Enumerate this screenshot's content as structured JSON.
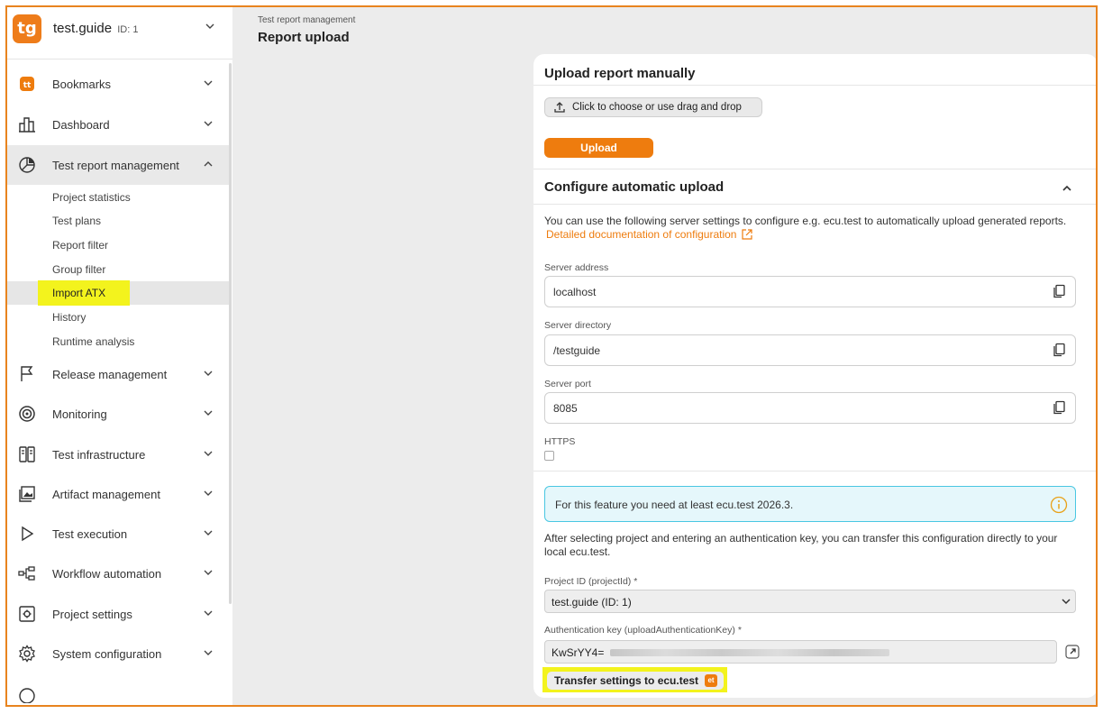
{
  "app": {
    "logo_text": "tg",
    "name": "test.guide",
    "id_label": "ID: 1"
  },
  "sidebar": {
    "items": [
      {
        "label": "Bookmarks",
        "icon": "bookmark-tt-icon"
      },
      {
        "label": "Dashboard",
        "icon": "bar-chart-icon"
      },
      {
        "label": "Test report management",
        "icon": "pie-chart-icon",
        "expanded": true
      },
      {
        "label": "Release management",
        "icon": "flag-icon"
      },
      {
        "label": "Monitoring",
        "icon": "radar-icon"
      },
      {
        "label": "Test infrastructure",
        "icon": "server-icon"
      },
      {
        "label": "Artifact management",
        "icon": "image-folder-icon"
      },
      {
        "label": "Test execution",
        "icon": "play-icon"
      },
      {
        "label": "Workflow automation",
        "icon": "workflow-icon"
      },
      {
        "label": "Project settings",
        "icon": "project-gear-icon"
      },
      {
        "label": "System configuration",
        "icon": "gear-icon"
      }
    ],
    "sub_items": [
      "Project statistics",
      "Test plans",
      "Report filter",
      "Group filter",
      "Import ATX",
      "History",
      "Runtime analysis"
    ],
    "selected_sub_item": "Import ATX"
  },
  "header": {
    "breadcrumb": "Test report management",
    "title": "Report upload"
  },
  "upload_manual": {
    "heading": "Upload report manually",
    "choose_label": "Click to choose or use drag and drop",
    "upload_label": "Upload"
  },
  "auto_upload": {
    "heading": "Configure automatic upload",
    "description": "You can use the following server settings to configure e.g. ecu.test to automatically upload generated reports.",
    "doc_link": "Detailed documentation of configuration",
    "server_address_label": "Server address",
    "server_address": "localhost",
    "server_directory_label": "Server directory",
    "server_directory": "/testguide",
    "server_port_label": "Server port",
    "server_port": "8085",
    "https_label": "HTTPS",
    "https_checked": false,
    "info_text": "For this feature you need at least ecu.test 2026.3.",
    "after_text": "After selecting project and entering an authentication key, you can transfer this configuration directly to your local ecu.test.",
    "project_label": "Project ID (projectId)",
    "required_marker": "*",
    "project_value": "test.guide (ID: 1)",
    "auth_label": "Authentication key (uploadAuthenticationKey)",
    "auth_value": "KwSrYY4=",
    "transfer_label": "Transfer settings to ecu.test",
    "transfer_badge": "et"
  },
  "colors": {
    "accent": "#ee7c0e",
    "highlight": "#f3f31d",
    "info_border": "#49c7e2",
    "info_bg": "#e5f7fb"
  }
}
